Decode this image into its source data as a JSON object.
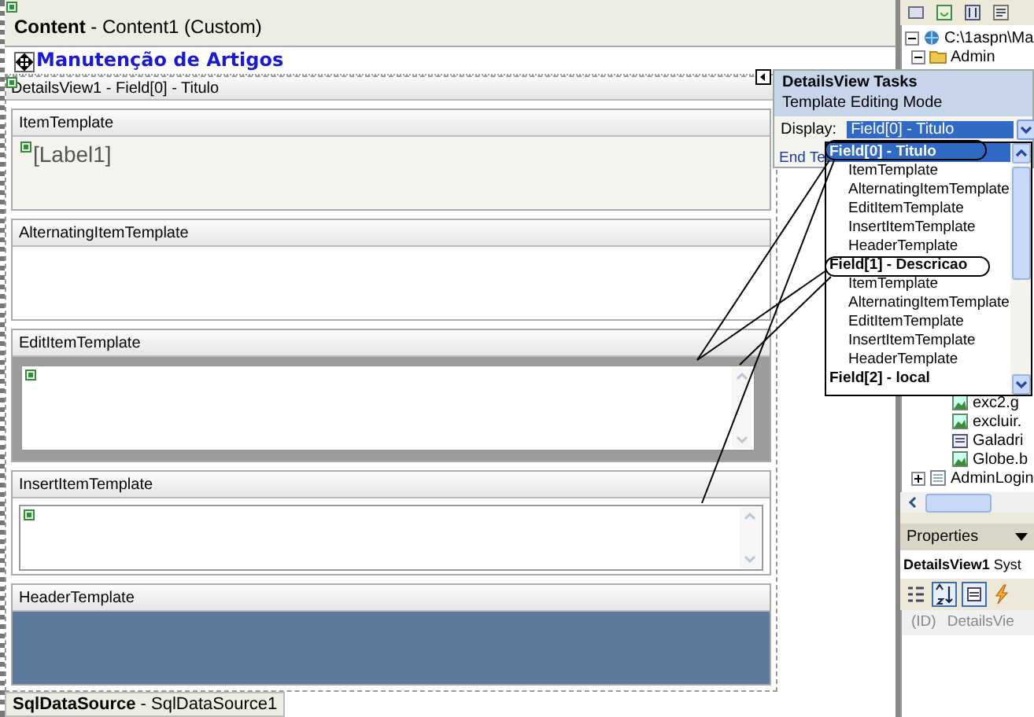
{
  "content_header": "**Content** - Content1 (Custom)",
  "page_title": "Manutenção de Artigos",
  "details_view": {
    "title": "DetailsView1 - Field[0] - Titulo",
    "templates": [
      {
        "kind": "label",
        "label": "ItemTemplate",
        "value": "[Label1]",
        "selected": false
      },
      {
        "kind": "empty",
        "label": "AlternatingItemTemplate",
        "selected": false
      },
      {
        "kind": "textarea",
        "label": "EditItemTemplate",
        "selected": true
      },
      {
        "kind": "textarea",
        "label": "InsertItemTemplate",
        "selected": false
      },
      {
        "kind": "header",
        "label": "HeaderTemplate",
        "selected": false
      }
    ]
  },
  "data_source_tab": "**SqlDataSource** - SqlDataSource1",
  "smart_tag": {
    "title": "DetailsView Tasks",
    "subtitle": "Template Editing Mode",
    "display_label": "Display:",
    "display_value": "Field[0] - Titulo",
    "link": "End Te"
  },
  "dropdown_list": [
    {
      "kind": "field",
      "label": "Field[0] - Titulo",
      "selected": true
    },
    {
      "kind": "template",
      "label": "ItemTemplate",
      "selected": false
    },
    {
      "kind": "template",
      "label": "AlternatingItemTemplate",
      "selected": false
    },
    {
      "kind": "template",
      "label": "EditItemTemplate",
      "selected": false
    },
    {
      "kind": "template",
      "label": "InsertItemTemplate",
      "selected": false
    },
    {
      "kind": "template",
      "label": "HeaderTemplate",
      "selected": false
    },
    {
      "kind": "field",
      "label": "Field[1] - Descricao",
      "selected": false
    },
    {
      "kind": "template",
      "label": "ItemTemplate",
      "selected": false
    },
    {
      "kind": "template",
      "label": "AlternatingItemTemplate",
      "selected": false
    },
    {
      "kind": "template",
      "label": "EditItemTemplate",
      "selected": false
    },
    {
      "kind": "template",
      "label": "InsertItemTemplate",
      "selected": false
    },
    {
      "kind": "template",
      "label": "HeaderTemplate",
      "selected": false
    },
    {
      "kind": "field",
      "label": "Field[2] - local",
      "selected": false
    }
  ],
  "solution_explorer": {
    "tree": [
      {
        "kind": "project",
        "label": "C:\\1aspn\\Ma",
        "expanded": true,
        "children": [
          {
            "kind": "folder",
            "label": "Admin",
            "expanded": true,
            "children": [
              {
                "kind": "image",
                "label": "exc2.g"
              },
              {
                "kind": "image",
                "label": "excluir."
              },
              {
                "kind": "doc",
                "label": "Galadri"
              },
              {
                "kind": "image",
                "label": "Globe.b"
              }
            ]
          },
          {
            "kind": "page",
            "label": "AdminLogin",
            "expanded": false
          }
        ]
      }
    ]
  },
  "properties": {
    "title": "Properties",
    "object": "**DetailsView1** Syst",
    "rows": [
      {
        "name": "(ID)",
        "value": "DetailsVie"
      }
    ]
  }
}
